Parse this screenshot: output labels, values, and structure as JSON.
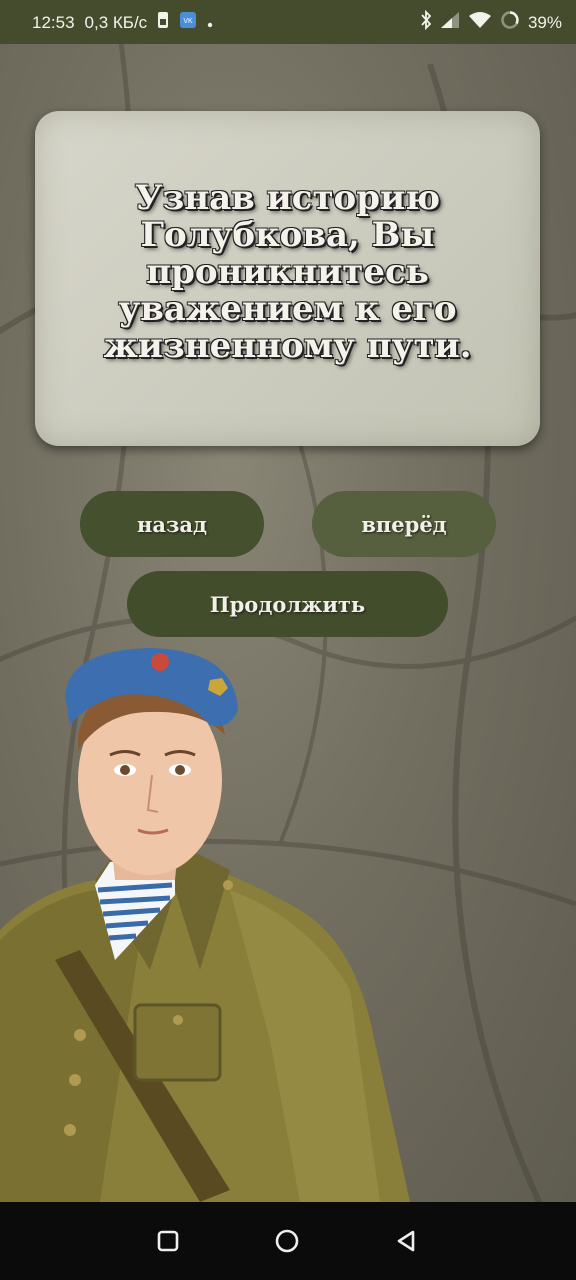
{
  "status_bar": {
    "time": "12:53",
    "network_speed": "0,3 КБ/с",
    "battery": "39%",
    "icons": [
      "sim-icon",
      "vk-icon",
      "dot-icon",
      "bluetooth-icon",
      "signal-icon",
      "wifi-icon",
      "battery-icon"
    ]
  },
  "card": {
    "text": "Узнав историю Голубкова, Вы проникнитесь уважением к его жизненному пути."
  },
  "buttons": {
    "back_label": "назад",
    "forward_label": "вперёд",
    "continue_label": "Продолжить"
  },
  "colors": {
    "status_bar_bg": "#454c2e",
    "button_dark": "#44502e",
    "button_light": "#56603f",
    "card_bg": "#cfcfc2"
  },
  "nav_bar": {
    "icons": [
      "recents-icon",
      "home-icon",
      "back-icon"
    ]
  }
}
